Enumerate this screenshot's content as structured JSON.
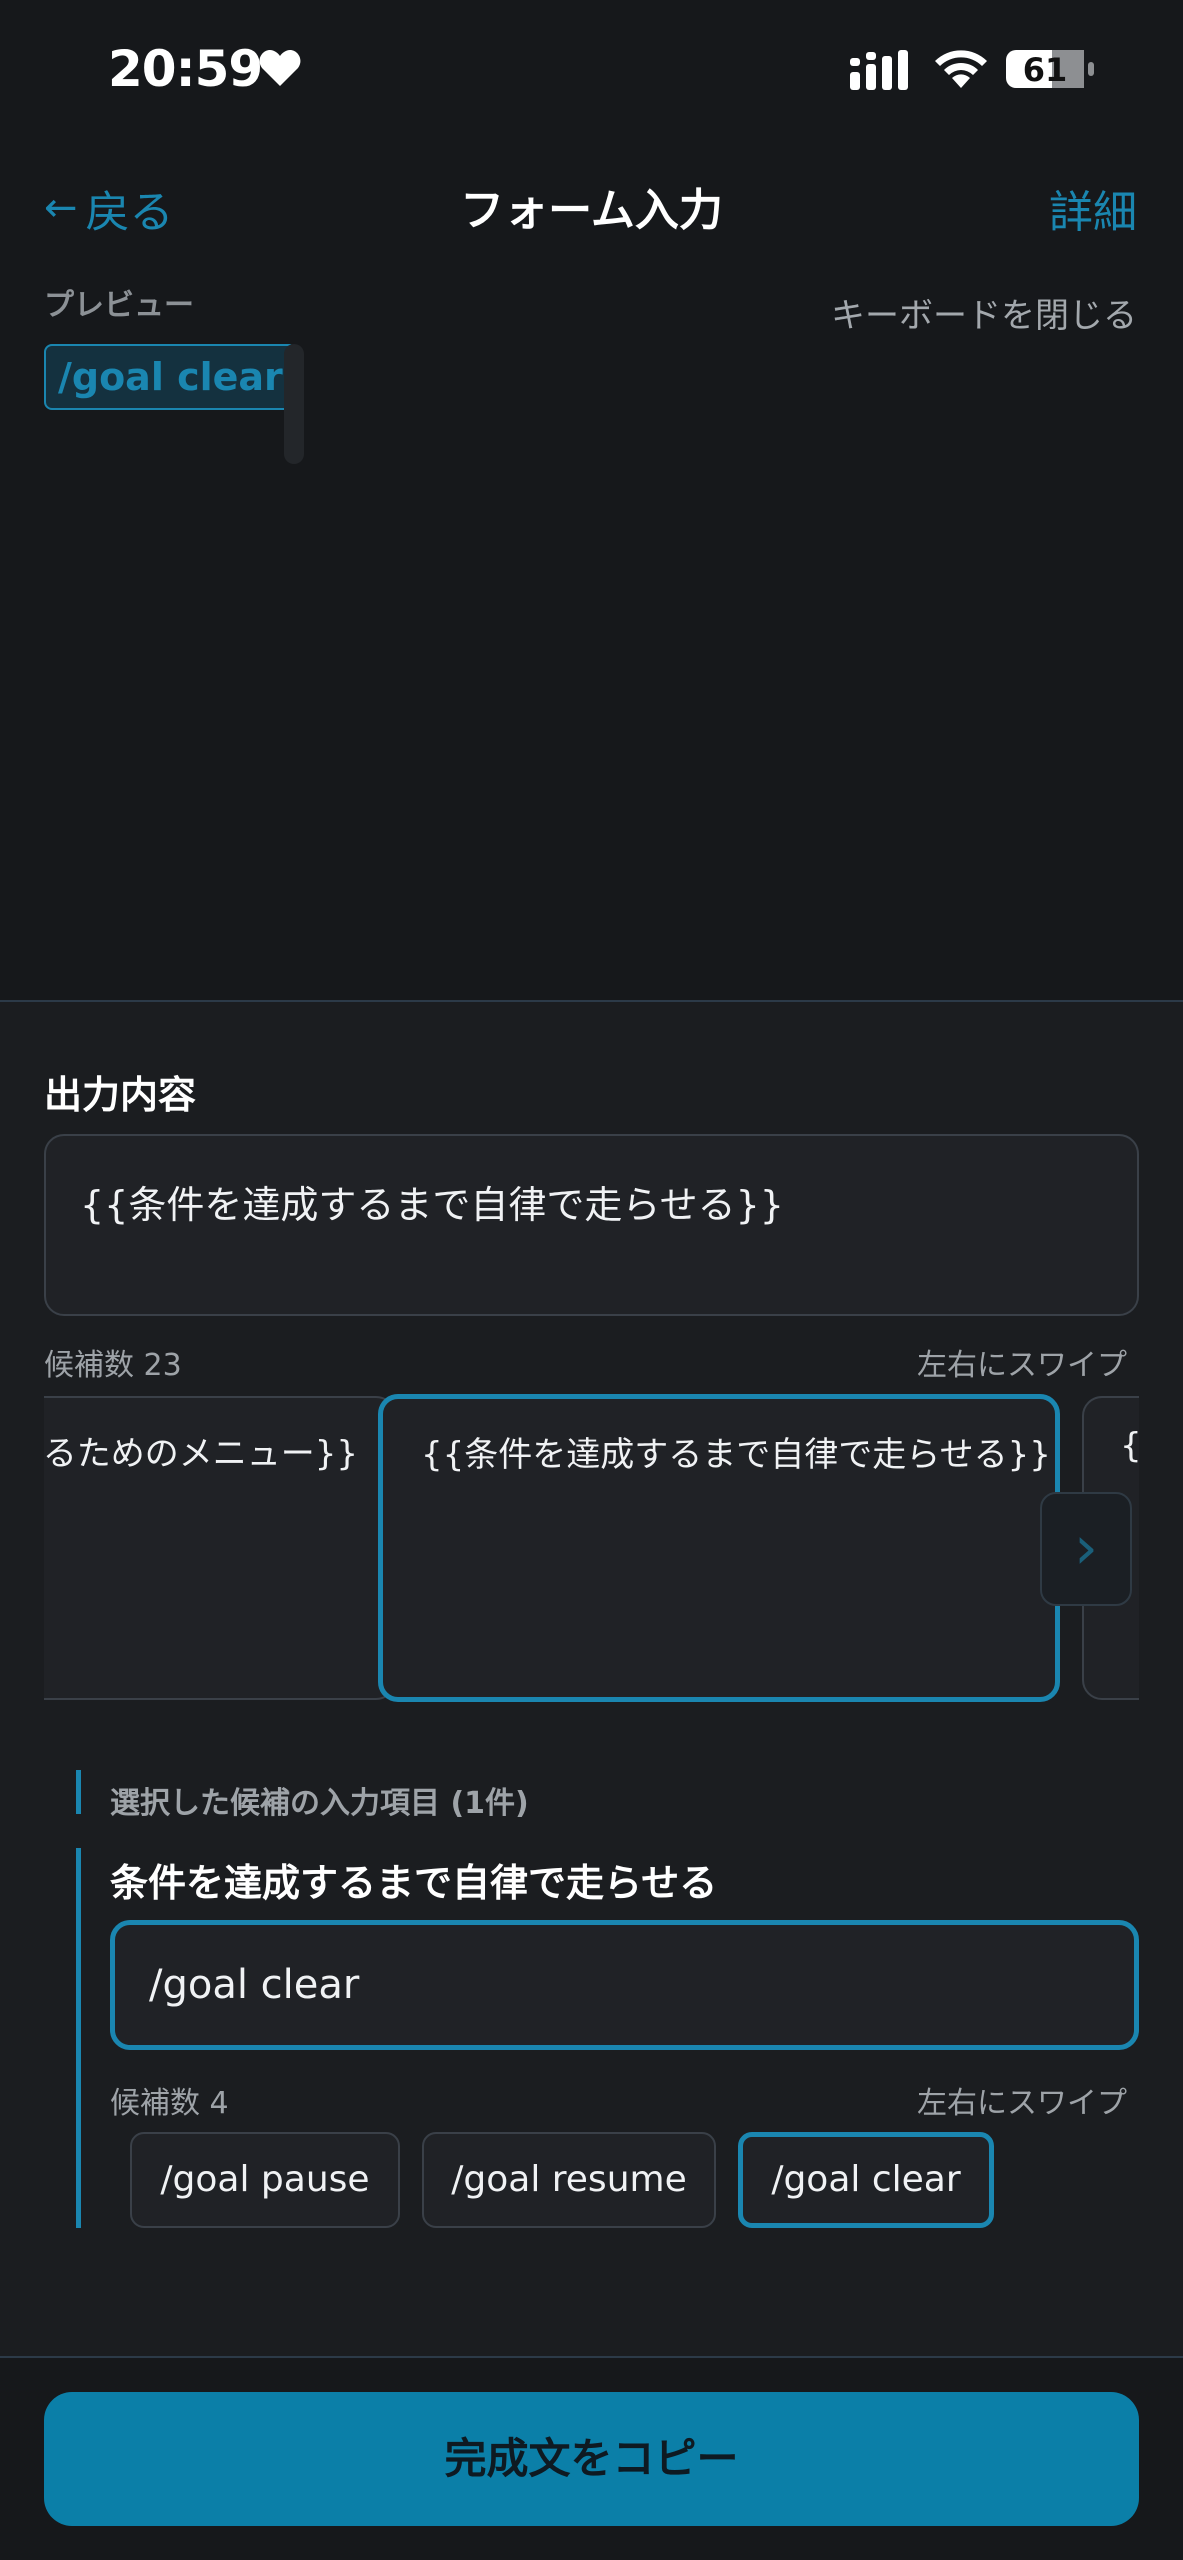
{
  "status_bar": {
    "time": "20:59",
    "battery": "61",
    "icons": [
      "heart-icon",
      "signal-icon",
      "wifi-icon",
      "battery-icon"
    ]
  },
  "nav": {
    "back_label": "戻る",
    "title": "フォーム入力",
    "detail_label": "詳細"
  },
  "preview": {
    "label": "プレビュー",
    "keyboard_close": "キーボードを閉じる",
    "chip": "/goal clear"
  },
  "output": {
    "title": "出力内容",
    "value": "{{条件を達成するまで自律で走らせる}}"
  },
  "candidates": {
    "count_label": "候補数 23",
    "swipe_hint": "左右にスワイプ",
    "cards": [
      "{{…するためのメニュー}}",
      "{{条件を達成するまで自律で走らせる}}",
      "{{"
    ]
  },
  "selected": {
    "label": "選択した候補の入力項目 (1件)",
    "field_title": "条件を達成するまで自律で走らせる",
    "field_value": "/goal clear",
    "count_label": "候補数 4",
    "swipe_hint": "左右にスワイプ",
    "options": [
      "/goal pause",
      "/goal resume",
      "/goal clear"
    ],
    "selected_index": 2
  },
  "footer": {
    "copy_label": "完成文をコピー"
  },
  "colors": {
    "accent": "#1a86b0",
    "background": "#16181b",
    "button": "#0b7fa8"
  }
}
